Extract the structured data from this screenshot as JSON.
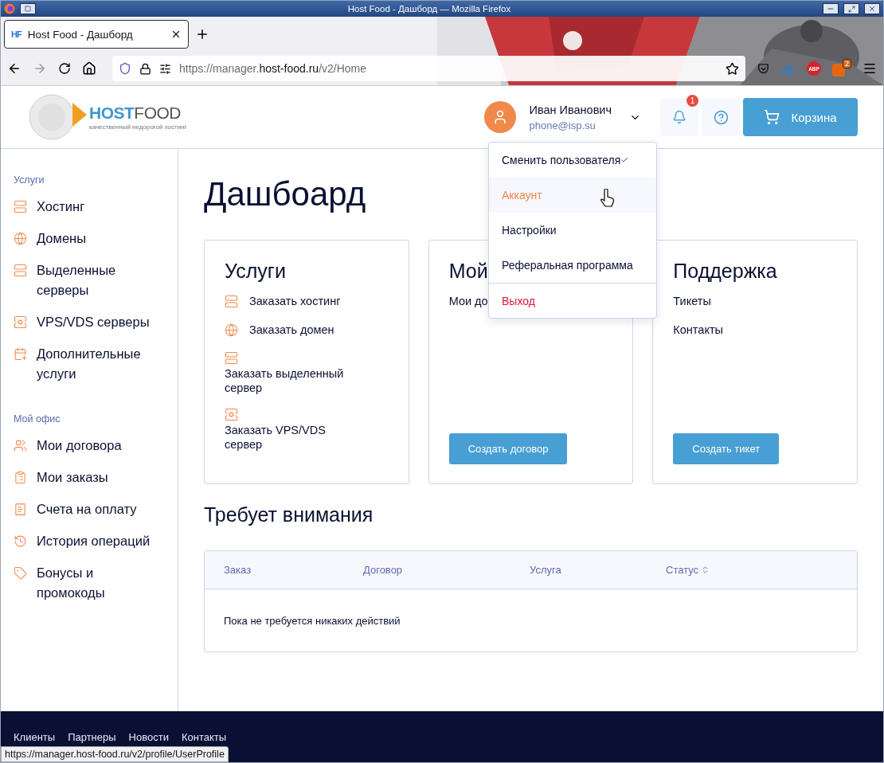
{
  "browser": {
    "window_title": "Host Food - Дашборд — Mozilla Firefox",
    "tabs": [
      {
        "favicon": "HF",
        "title": "Host Food - Дашборд",
        "selected": true
      }
    ],
    "url": {
      "prefix": "https://manager.",
      "domain": "host-food.ru",
      "path": "/v2/Home"
    },
    "adblock_label": "ABP",
    "extension_badge": "2",
    "status_url": "https://manager.host-food.ru/v2/profile/UserProfile"
  },
  "header": {
    "logo": {
      "brand_first": "HOST",
      "brand_second": "FOOD",
      "tagline": "качественный недорогой хостинг"
    },
    "user": {
      "name": "Иван Иванович",
      "email": "phone@isp.su"
    },
    "notification_count": "1",
    "cart_label": "Корзина"
  },
  "user_menu": [
    {
      "label": "Сменить пользователя",
      "kind": "submenu",
      "highlighted": false
    },
    {
      "label": "Аккаунт",
      "kind": "link",
      "highlighted": true
    },
    {
      "label": "Настройки",
      "kind": "link",
      "highlighted": false
    },
    {
      "label": "Реферальная программа",
      "kind": "link",
      "highlighted": false
    },
    {
      "label": "Выход",
      "kind": "logout",
      "highlighted": false
    }
  ],
  "sidebar": [
    {
      "title": "Услуги",
      "items": [
        "Хостинг",
        "Домены",
        "Выделенные серверы",
        "VPS/VDS серверы",
        "Дополнительные услуги"
      ]
    },
    {
      "title": "Мой офис",
      "items": [
        "Мои договора",
        "Мои заказы",
        "Счета на оплату",
        "История операций",
        "Бонусы и промокоды"
      ]
    }
  ],
  "page_title": "Дашбоард",
  "cards": [
    {
      "title": "Услуги",
      "links": [
        {
          "label": "Заказать хостинг",
          "kind": "inline"
        },
        {
          "label": "Заказать домен",
          "kind": "inline"
        },
        {
          "label": "Заказать выделенный сервер",
          "kind": "stacked"
        },
        {
          "label": "Заказать VPS/VDS сервер",
          "kind": "stacked"
        }
      ]
    },
    {
      "title": "Мой",
      "links": [
        {
          "label": "Мои до",
          "kind": "plain"
        }
      ],
      "button": "Создать договор"
    },
    {
      "title": "Поддержка",
      "links": [
        {
          "label": "Тикеты",
          "kind": "plain"
        },
        {
          "label": "Контакты",
          "kind": "plain"
        }
      ],
      "button": "Создать тикет"
    }
  ],
  "attention": {
    "title": "Требует внимания",
    "columns": [
      {
        "label": "Заказ",
        "sortable": false
      },
      {
        "label": "Договор",
        "sortable": false
      },
      {
        "label": "Услуга",
        "sortable": false
      },
      {
        "label": "Статус",
        "sortable": true
      }
    ],
    "empty_message": "Пока не требуется никаких действий"
  },
  "footer_links": [
    "Клиенты",
    "Партнеры",
    "Новости",
    "Контакты"
  ]
}
